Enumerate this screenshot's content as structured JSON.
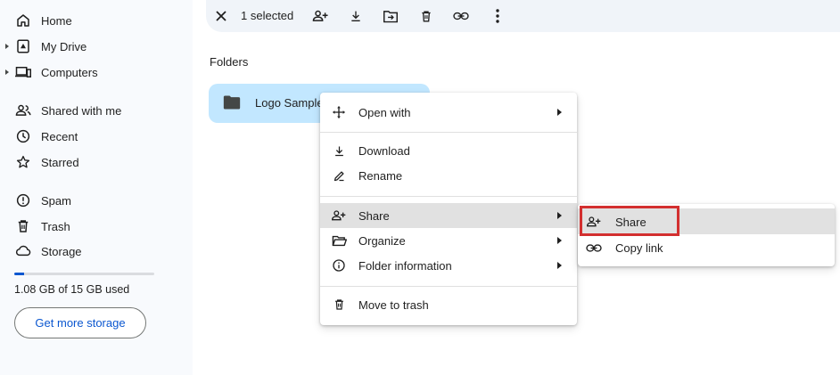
{
  "sidebar": {
    "items": [
      {
        "label": "Home",
        "icon": "home-icon"
      },
      {
        "label": "My Drive",
        "icon": "drive-icon"
      },
      {
        "label": "Computers",
        "icon": "computers-icon"
      },
      {
        "label": "Shared with me",
        "icon": "people-icon"
      },
      {
        "label": "Recent",
        "icon": "clock-icon"
      },
      {
        "label": "Starred",
        "icon": "star-icon"
      },
      {
        "label": "Spam",
        "icon": "spam-icon"
      },
      {
        "label": "Trash",
        "icon": "trash-icon"
      },
      {
        "label": "Storage",
        "icon": "cloud-icon"
      }
    ],
    "storage": {
      "used_text": "1.08 GB of 15 GB used",
      "used_fraction": 0.072,
      "button_label": "Get more storage"
    }
  },
  "toolbar": {
    "selected_text": "1 selected",
    "actions": [
      "close-icon",
      "share-icon",
      "download-icon",
      "move-icon",
      "trash-icon",
      "link-icon",
      "more-icon"
    ]
  },
  "main": {
    "section_label": "Folders",
    "folder_name": "Logo Sample"
  },
  "context_menu": {
    "items": [
      {
        "label": "Open with",
        "icon": "open-with-icon",
        "has_submenu": true
      },
      {
        "label": "Download",
        "icon": "download-icon",
        "has_submenu": false
      },
      {
        "label": "Rename",
        "icon": "rename-icon",
        "has_submenu": false
      },
      {
        "label": "Share",
        "icon": "share-icon",
        "has_submenu": true,
        "highlighted": true
      },
      {
        "label": "Organize",
        "icon": "folder-open-icon",
        "has_submenu": true
      },
      {
        "label": "Folder information",
        "icon": "info-icon",
        "has_submenu": true
      },
      {
        "label": "Move to trash",
        "icon": "trash-icon",
        "has_submenu": false
      }
    ]
  },
  "share_submenu": {
    "items": [
      {
        "label": "Share",
        "icon": "share-icon",
        "highlighted": true
      },
      {
        "label": "Copy link",
        "icon": "link-icon"
      }
    ]
  },
  "colors": {
    "sidebar_bg": "#f8fafd",
    "toolbar_bg": "#f0f4f9",
    "selected_folder_bg": "#c2e7ff",
    "accent": "#0b57d0",
    "hover_bg": "#e1e1e1",
    "annotation_red": "#d32f2f"
  }
}
